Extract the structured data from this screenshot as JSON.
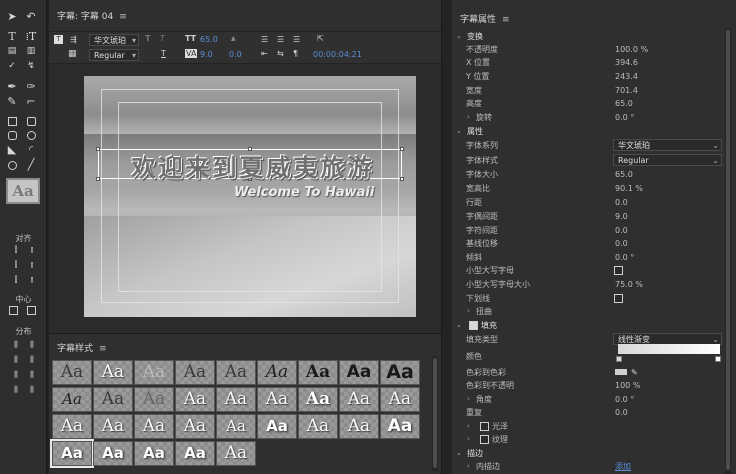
{
  "editor": {
    "title": "字幕: 字幕 04",
    "menu": "≡",
    "font_family": "华文琥珀",
    "font_style": "Regular",
    "font_size": "65.0",
    "kerning": "9.0",
    "rotation_value": "0.0",
    "timecode": "00:00:04:21",
    "title_cn": "欢迎来到夏威夷旅游",
    "title_en": "Welcome To Hawaii",
    "marker_T": "T",
    "aa_label": "Aa"
  },
  "tools_panel": {
    "align_label": "对齐",
    "center_label": "中心",
    "distribute_label": "分布",
    "preview_label": "Aa"
  },
  "styles_panel": {
    "title": "字幕样式",
    "menu": "≡",
    "rows": [
      [
        "Aa",
        "Aa",
        "Aa",
        "Aa",
        "Aa",
        "Aa",
        "Aa",
        "Aa",
        "Aa"
      ],
      [
        "Aa",
        "Aa",
        "Aa",
        "Aa",
        "Aa",
        "Aa",
        "Aa",
        "Aa",
        "Aa"
      ],
      [
        "Aa",
        "Aa",
        "Aa",
        "Aa",
        "Aa",
        "Aa",
        "Aa",
        "Aa",
        "Aa"
      ],
      [
        "Aa",
        "Aa",
        "Aa",
        "Aa",
        "Aa"
      ]
    ]
  },
  "properties": {
    "title": "字幕属性",
    "menu": "≡",
    "transform": {
      "label": "变换",
      "opacity_label": "不透明度",
      "opacity": "100.0 %",
      "x_label": "X 位置",
      "x": "394.6",
      "y_label": "Y 位置",
      "y": "243.4",
      "width_label": "宽度",
      "width": "701.4",
      "height_label": "高度",
      "height": "65.0",
      "rotation_label": "旋转",
      "rotation": "0.0 °"
    },
    "attributes": {
      "label": "属性",
      "family_label": "字体系列",
      "family": "华文琥珀",
      "style_label": "字体样式",
      "style": "Regular",
      "size_label": "字体大小",
      "size": "65.0",
      "aspect_label": "宽高比",
      "aspect": "90.1 %",
      "leading_label": "行距",
      "leading": "0.0",
      "kerning_label": "字偶间距",
      "kerning": "9.0",
      "tracking_label": "字符间距",
      "tracking": "0.0",
      "baseline_label": "基线位移",
      "baseline": "0.0",
      "slant_label": "倾斜",
      "slant": "0.0 °",
      "smallcaps_label": "小型大写字母",
      "smallcaps_size_label": "小型大写字母大小",
      "smallcaps_size": "75.0 %",
      "underline_label": "下划线",
      "distort_label": "扭曲"
    },
    "fill": {
      "label": "填充",
      "type_label": "填充类型",
      "type": "线性渐变",
      "color_label": "颜色",
      "color_to_color_label": "色彩到色彩",
      "color_opacity_label": "色彩到不透明",
      "color_opacity": "100 %",
      "angle_label": "角度",
      "angle": "0.0 °",
      "repeat_label": "重复",
      "repeat": "0.0",
      "sheen_label": "光泽",
      "texture_label": "纹理"
    },
    "stroke": {
      "label": "描边",
      "inner_label": "内描边",
      "add_label": "添加"
    }
  }
}
